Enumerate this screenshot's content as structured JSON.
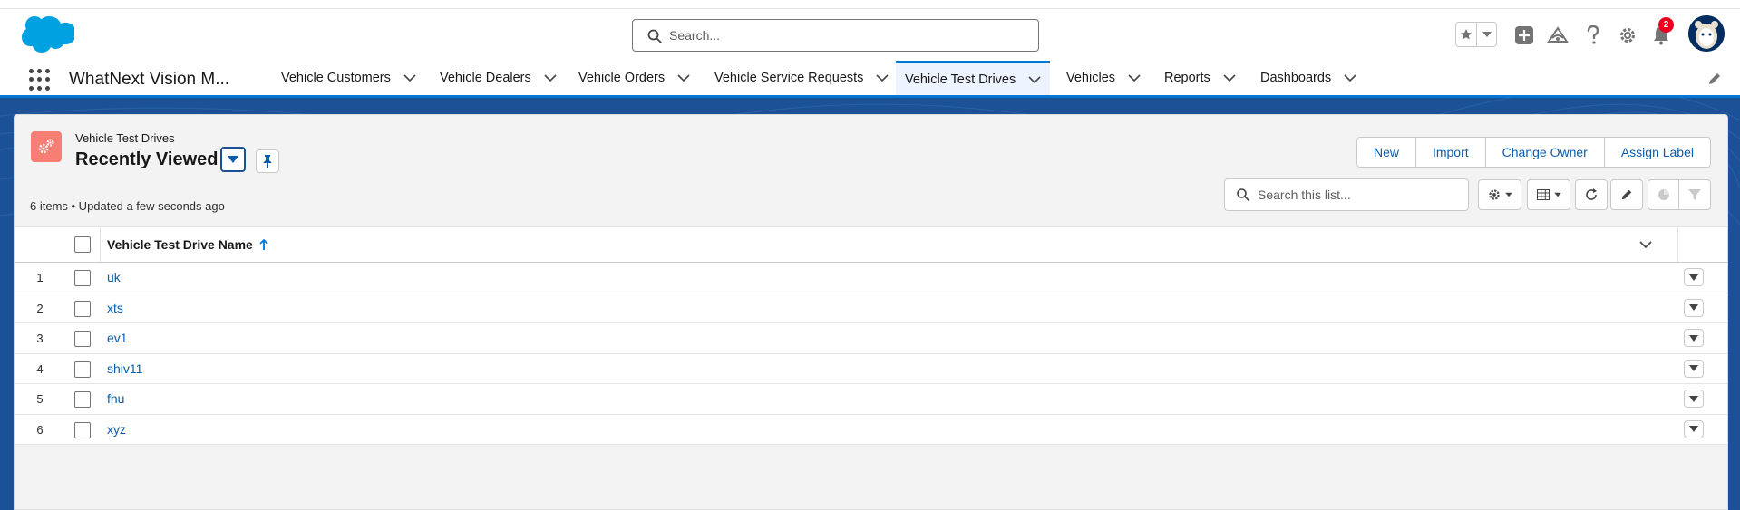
{
  "header": {
    "search_placeholder": "Search...",
    "notification_count": "2"
  },
  "nav": {
    "app_name": "WhatNext Vision M...",
    "items": [
      {
        "label": "Vehicle Customers"
      },
      {
        "label": "Vehicle Dealers"
      },
      {
        "label": "Vehicle Orders"
      },
      {
        "label": "Vehicle Service Requests"
      },
      {
        "label": "Vehicle Test Drives",
        "active": true
      },
      {
        "label": "Vehicles"
      },
      {
        "label": "Reports"
      },
      {
        "label": "Dashboards"
      }
    ]
  },
  "list_view": {
    "object_label": "Vehicle Test Drives",
    "title": "Recently Viewed",
    "meta": "6 items • Updated a few seconds ago",
    "actions": {
      "new": "New",
      "import": "Import",
      "change_owner": "Change Owner",
      "assign_label": "Assign Label"
    },
    "search_placeholder": "Search this list...",
    "column_header": "Vehicle Test Drive Name",
    "rows": [
      {
        "num": "1",
        "name": "uk"
      },
      {
        "num": "2",
        "name": "xts"
      },
      {
        "num": "3",
        "name": "ev1"
      },
      {
        "num": "4",
        "name": "shiv11"
      },
      {
        "num": "5",
        "name": "fhu"
      },
      {
        "num": "6",
        "name": "xyz"
      }
    ]
  },
  "colors": {
    "brand_blue": "#0176d3",
    "link": "#0b5cab",
    "object_icon": "#f77e75",
    "background": "#1b5297"
  }
}
